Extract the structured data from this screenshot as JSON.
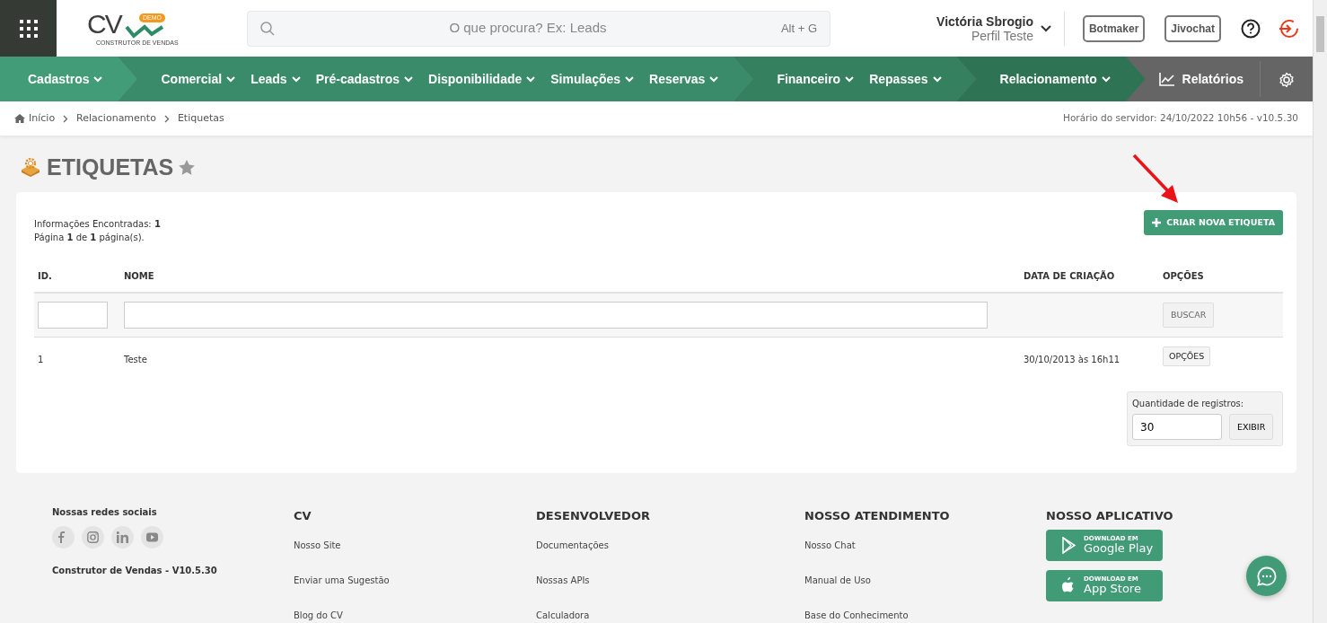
{
  "header": {
    "logo": {
      "mark": "CV",
      "badge": "DEMO",
      "tagline": "CONSTRUTOR DE VENDAS"
    },
    "search": {
      "placeholder": "O que procura? Ex: Leads",
      "shortcut": "Alt + G"
    },
    "user": {
      "name": "Victória Sbrogio",
      "profile": "Perfil Teste"
    },
    "buttons": [
      "Botmaker",
      "Jivochat"
    ]
  },
  "nav": {
    "groups": [
      {
        "color": "#419c77",
        "items": [
          "Cadastros"
        ]
      },
      {
        "color": "#3a8b69",
        "items": [
          "Comercial",
          "Leads",
          "Pré-cadastros",
          "Disponibilidade",
          "Simulações",
          "Reservas"
        ]
      },
      {
        "color": "#35805f",
        "items": [
          "Financeiro",
          "Repasses"
        ]
      },
      {
        "color": "#2f7355",
        "items": [
          "Relacionamento"
        ]
      }
    ],
    "reports": "Relatórios"
  },
  "breadcrumb": {
    "items": [
      "Início",
      "Relacionamento",
      "Etiquetas"
    ],
    "server_time": "Horário do servidor: 24/10/2022 10h56 - v10.5.30"
  },
  "page": {
    "title": "ETIQUETAS"
  },
  "summary": [
    "Informações Encontradas: **1**",
    "Página **1** de **1** página(s)."
  ],
  "create_button": "CRIAR NOVA ETIQUETA",
  "table": {
    "columns": [
      "ID.",
      "NOME",
      "DATA DE CRIAÇÃO",
      "OPÇÕES"
    ],
    "search_button": "BUSCAR",
    "rows": [
      {
        "id": "1",
        "name": "Teste",
        "created": "30/10/2013 às 16h11",
        "action": "OPÇÕES"
      }
    ]
  },
  "page_size": {
    "label": "Quantidade de registros:",
    "value": "30",
    "button": "EXIBIR"
  },
  "footer": {
    "social_title": "Nossas redes sociais",
    "version": "Construtor de Vendas - V10.5.30",
    "columns": [
      {
        "title": "CV",
        "links": [
          "Nosso Site",
          "Enviar uma Sugestão",
          "Blog do CV"
        ]
      },
      {
        "title": "DESENVOLVEDOR",
        "links": [
          "Documentações",
          "Nossas APIs",
          "Calculadora"
        ]
      },
      {
        "title": "NOSSO ATENDIMENTO",
        "links": [
          "Nosso Chat",
          "Manual de Uso",
          "Base do Conhecimento"
        ]
      }
    ],
    "app_title": "NOSSO APLICATIVO",
    "stores": [
      {
        "kind": "google",
        "small": "DOWNLOAD EM",
        "big": "Google Play"
      },
      {
        "kind": "apple",
        "small": "DOWNLOAD EM",
        "big": "App Store"
      }
    ]
  }
}
